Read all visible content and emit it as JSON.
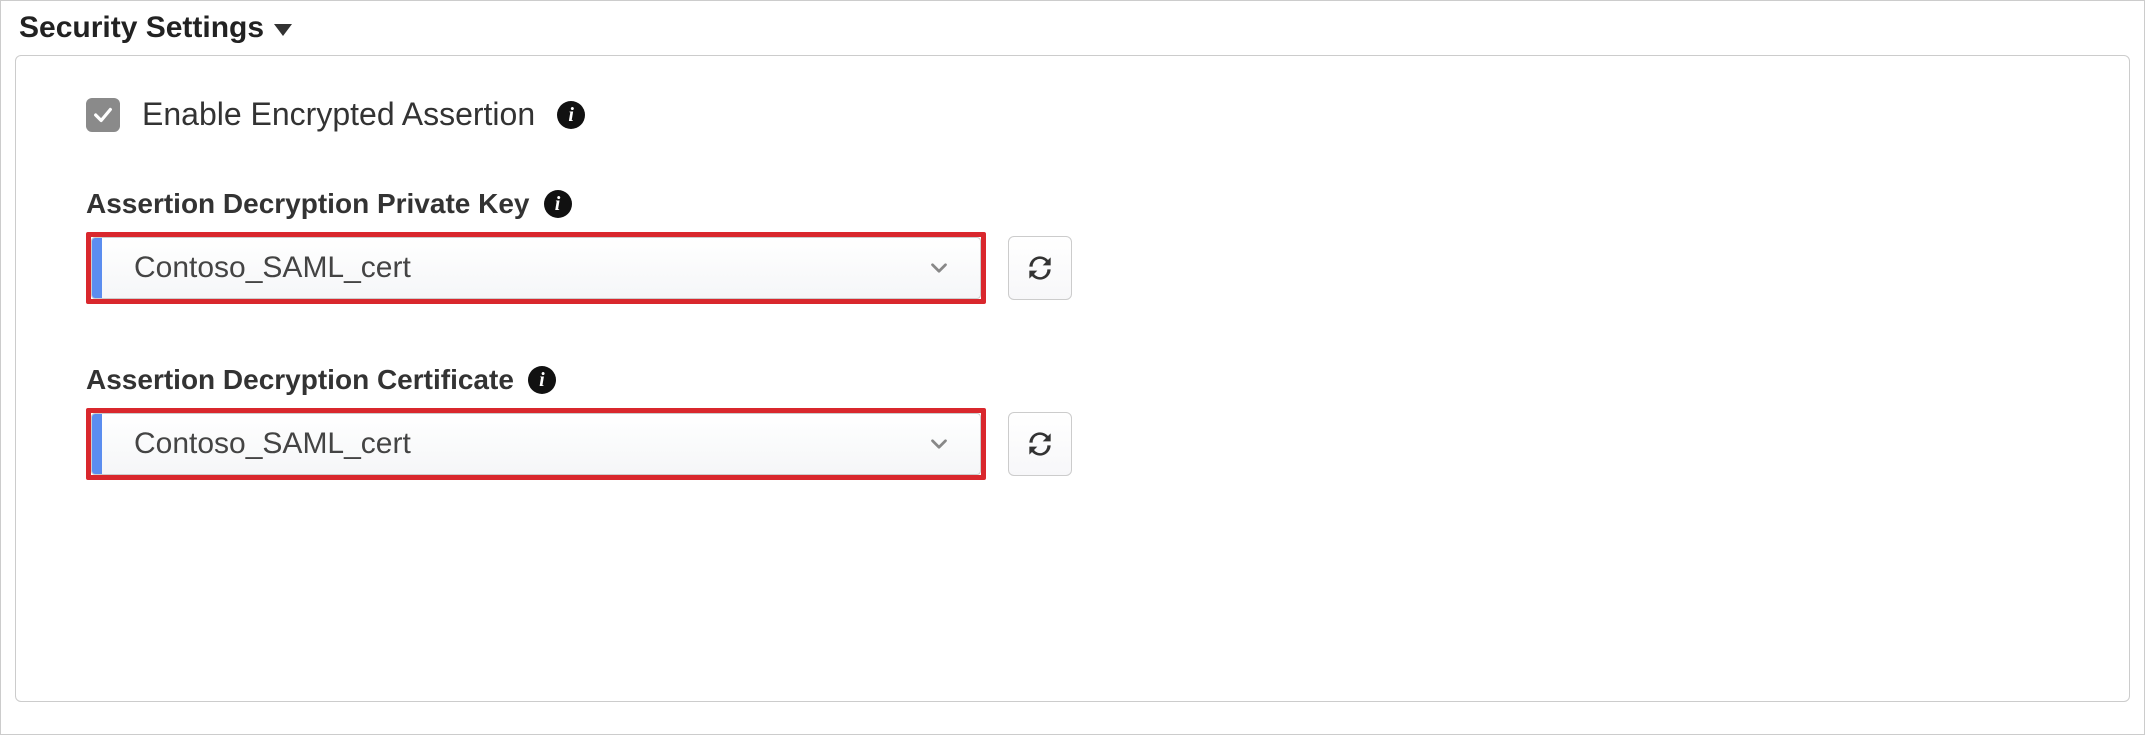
{
  "section": {
    "title": "Security Settings"
  },
  "fields": {
    "enable_encrypted_assertion": {
      "label": "Enable Encrypted Assertion",
      "checked": true
    },
    "decrypt_private_key": {
      "label": "Assertion Decryption Private Key",
      "value": "Contoso_SAML_cert"
    },
    "decrypt_certificate": {
      "label": "Assertion Decryption Certificate",
      "value": "Contoso_SAML_cert"
    }
  }
}
